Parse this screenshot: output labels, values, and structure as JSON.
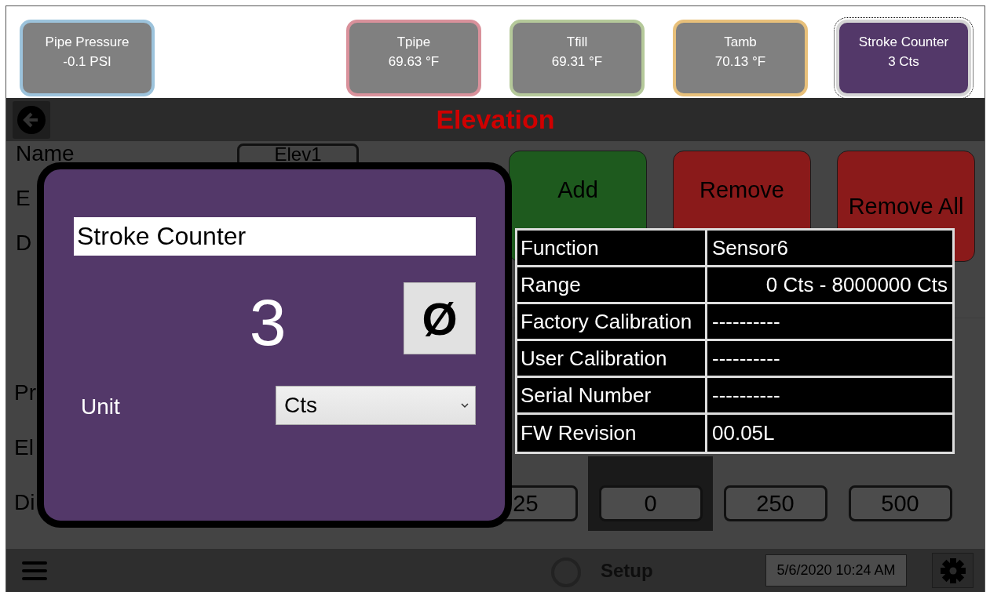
{
  "sensor_tiles": [
    {
      "label": "Pipe Pressure",
      "value": "-0.1 PSI",
      "color": "#9cc3dc",
      "selected": false
    },
    {
      "label": "Tpipe",
      "value": "69.63 °F",
      "color": "#d9919b",
      "selected": false
    },
    {
      "label": "Tfill",
      "value": "69.31 °F",
      "color": "#b5c99a",
      "selected": false
    },
    {
      "label": "Tamb",
      "value": "70.13 °F",
      "color": "#e8c07a",
      "selected": false
    },
    {
      "label": "Stroke Counter",
      "value": "3 Cts",
      "color": "#d4d4d4",
      "selected": true
    }
  ],
  "page": {
    "title": "Elevation",
    "name_label": "Name",
    "name_value": "Elev1",
    "side_labels": [
      "E",
      "D",
      "Pr",
      "El",
      "Di"
    ],
    "buttons": [
      {
        "label": "Add",
        "kind": "add"
      },
      {
        "label": "Remove",
        "kind": "remove"
      },
      {
        "label": "Remove All",
        "kind": "remove_all"
      }
    ],
    "distance_values": [
      {
        "value": "25",
        "selected": false
      },
      {
        "value": "0",
        "selected": true
      },
      {
        "value": "250",
        "selected": false
      },
      {
        "value": "500",
        "selected": false
      }
    ]
  },
  "dialog": {
    "name_value": "Stroke Counter",
    "reading": "3",
    "zero_button": "Ø",
    "unit_label": "Unit",
    "unit_value": "Cts"
  },
  "info_table": {
    "rows": [
      {
        "label": "Function",
        "value": "Sensor6",
        "kind": "text"
      },
      {
        "label": "Range",
        "value": "0 Cts -  8000000 Cts",
        "kind": "range"
      },
      {
        "label": "Factory Calibration",
        "value": "----------",
        "kind": "text"
      },
      {
        "label": "User Calibration",
        "value": "----------",
        "kind": "text"
      },
      {
        "label": "Serial Number",
        "value": "----------",
        "kind": "text"
      },
      {
        "label": "FW Revision",
        "value": "00.05L",
        "kind": "text"
      }
    ]
  },
  "status_bar": {
    "mode": "Setup",
    "datetime": "5/6/2020 10:24 AM"
  }
}
